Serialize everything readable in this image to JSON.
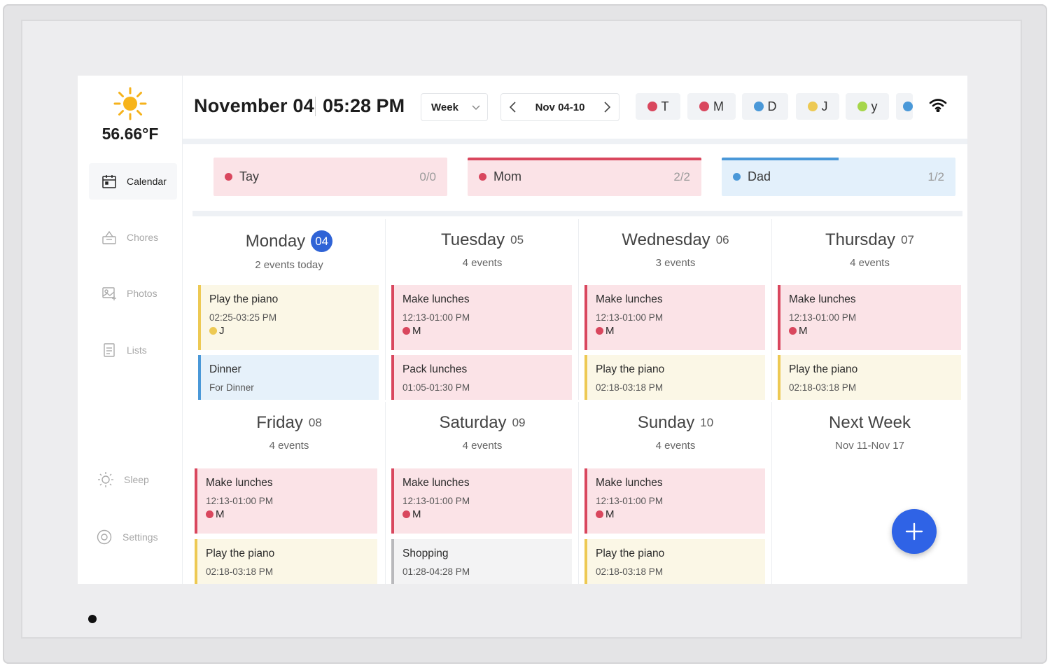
{
  "weather": {
    "icon": "sun-icon",
    "temperature": "56.66°F"
  },
  "sidebar": {
    "items": [
      {
        "label": "Calendar",
        "icon": "calendar-icon",
        "active": true
      },
      {
        "label": "Chores",
        "icon": "chores-icon",
        "active": false
      },
      {
        "label": "Photos",
        "icon": "photos-icon",
        "active": false
      },
      {
        "label": "Lists",
        "icon": "lists-icon",
        "active": false
      },
      {
        "label": "Sleep",
        "icon": "sleep-icon",
        "active": false
      },
      {
        "label": "Settings",
        "icon": "settings-icon",
        "active": false
      }
    ]
  },
  "header": {
    "date": "November 04",
    "time": "05:28 PM",
    "view": "Week",
    "range": "Nov 04-10",
    "members": [
      {
        "initial": "T",
        "color": "#d9475e"
      },
      {
        "initial": "M",
        "color": "#d9475e"
      },
      {
        "initial": "D",
        "color": "#4a98d8"
      },
      {
        "initial": "J",
        "color": "#edc953"
      },
      {
        "initial": "y",
        "color": "#a6d64a"
      },
      {
        "initial": "",
        "color": "#4a98d8"
      }
    ]
  },
  "progress": [
    {
      "name": "Tay",
      "count": "0/0",
      "fraction": 0,
      "dot": "#d9475e",
      "bg": "#fbe3e7",
      "bar": "#d9475e"
    },
    {
      "name": "Mom",
      "count": "2/2",
      "fraction": 1,
      "dot": "#d9475e",
      "bg": "#fbe3e7",
      "bar": "#d9475e"
    },
    {
      "name": "Dad",
      "count": "1/2",
      "fraction": 0.5,
      "dot": "#4a98d8",
      "bg": "#e3f0fb",
      "bar": "#4a98d8"
    }
  ],
  "days": [
    {
      "name": "Monday",
      "num": "04",
      "today": true,
      "summary": "2 events today",
      "events": [
        {
          "title": "Play the piano",
          "time": "02:25-03:25 PM",
          "who": "J",
          "dot": "#edc953",
          "bg": "#fbf7e6",
          "border": "#edc953"
        },
        {
          "title": "Dinner",
          "time": "For Dinner",
          "who": "",
          "dot": "",
          "bg": "#e6f1fa",
          "border": "#4a98d8"
        }
      ]
    },
    {
      "name": "Tuesday",
      "num": "05",
      "today": false,
      "summary": "4 events",
      "events": [
        {
          "title": "Make lunches",
          "time": "12:13-01:00 PM",
          "who": "M",
          "dot": "#d9475e",
          "bg": "#fbe3e7",
          "border": "#d9475e"
        },
        {
          "title": "Pack lunches",
          "time": "01:05-01:30 PM",
          "who": "",
          "dot": "",
          "bg": "#fbe3e7",
          "border": "#d9475e"
        }
      ]
    },
    {
      "name": "Wednesday",
      "num": "06",
      "today": false,
      "summary": "3 events",
      "events": [
        {
          "title": "Make lunches",
          "time": "12:13-01:00 PM",
          "who": "M",
          "dot": "#d9475e",
          "bg": "#fbe3e7",
          "border": "#d9475e"
        },
        {
          "title": "Play the piano",
          "time": "02:18-03:18 PM",
          "who": "",
          "dot": "",
          "bg": "#fbf7e6",
          "border": "#edc953"
        }
      ]
    },
    {
      "name": "Thursday",
      "num": "07",
      "today": false,
      "summary": "4 events",
      "events": [
        {
          "title": "Make lunches",
          "time": "12:13-01:00 PM",
          "who": "M",
          "dot": "#d9475e",
          "bg": "#fbe3e7",
          "border": "#d9475e"
        },
        {
          "title": "Play the piano",
          "time": "02:18-03:18 PM",
          "who": "",
          "dot": "",
          "bg": "#fbf7e6",
          "border": "#edc953"
        }
      ]
    },
    {
      "name": "Friday",
      "num": "08",
      "today": false,
      "summary": "4 events",
      "events": [
        {
          "title": "Make lunches",
          "time": "12:13-01:00 PM",
          "who": "M",
          "dot": "#d9475e",
          "bg": "#fbe3e7",
          "border": "#d9475e"
        },
        {
          "title": "Play the piano",
          "time": "02:18-03:18 PM",
          "who": "",
          "dot": "",
          "bg": "#fbf7e6",
          "border": "#edc953"
        }
      ]
    },
    {
      "name": "Saturday",
      "num": "09",
      "today": false,
      "summary": "4 events",
      "events": [
        {
          "title": "Make lunches",
          "time": "12:13-01:00 PM",
          "who": "M",
          "dot": "#d9475e",
          "bg": "#fbe3e7",
          "border": "#d9475e"
        },
        {
          "title": "Shopping",
          "time": "01:28-04:28 PM",
          "who": "",
          "dot": "",
          "bg": "#f3f3f4",
          "border": "#b9b9bc"
        }
      ]
    },
    {
      "name": "Sunday",
      "num": "10",
      "today": false,
      "summary": "4 events",
      "events": [
        {
          "title": "Make lunches",
          "time": "12:13-01:00 PM",
          "who": "M",
          "dot": "#d9475e",
          "bg": "#fbe3e7",
          "border": "#d9475e"
        },
        {
          "title": "Play the piano",
          "time": "02:18-03:18 PM",
          "who": "",
          "dot": "",
          "bg": "#fbf7e6",
          "border": "#edc953"
        }
      ]
    }
  ],
  "next_week": {
    "title": "Next Week",
    "range": "Nov 11-Nov 17"
  },
  "fab": {
    "icon": "plus-icon",
    "color": "#2f63e6"
  }
}
